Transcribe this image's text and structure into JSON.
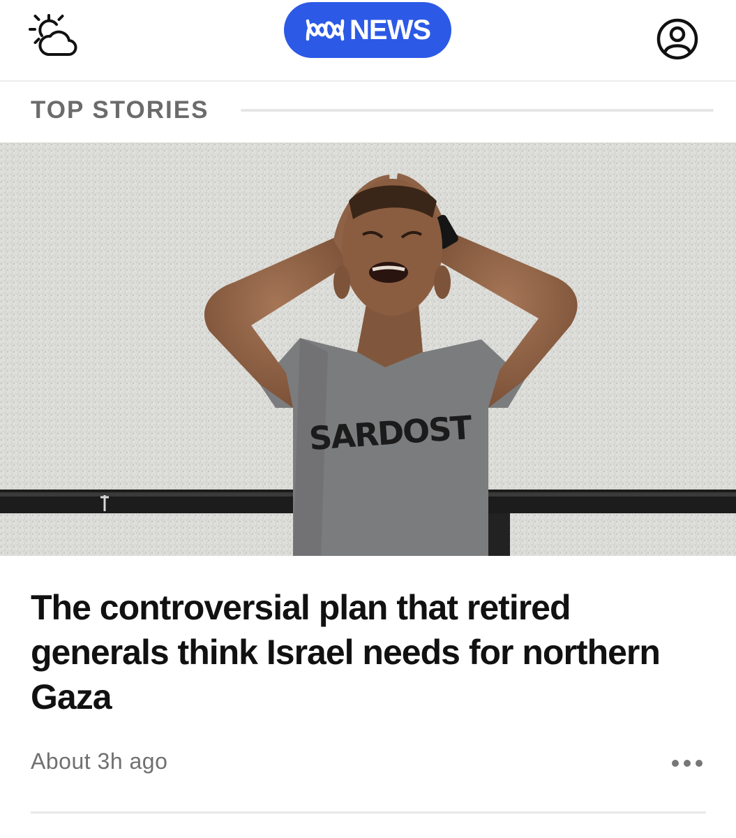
{
  "header": {
    "weather_icon": "partly-cloudy-icon",
    "brand_icon": "abc-lissajous-logo",
    "brand_label": "NEWS",
    "account_icon": "user-account-icon",
    "accent_color": "#2c5ae6"
  },
  "section": {
    "title": "TOP STORIES"
  },
  "story": {
    "image_description": "young man crying with hands on head against a white textured wall",
    "image_shirt_text": "SARDOST",
    "headline": "The controversial plan that retired generals think Israel needs for northern Gaza",
    "timestamp": "About 3h ago",
    "more_icon": "more-horizontal-icon"
  }
}
